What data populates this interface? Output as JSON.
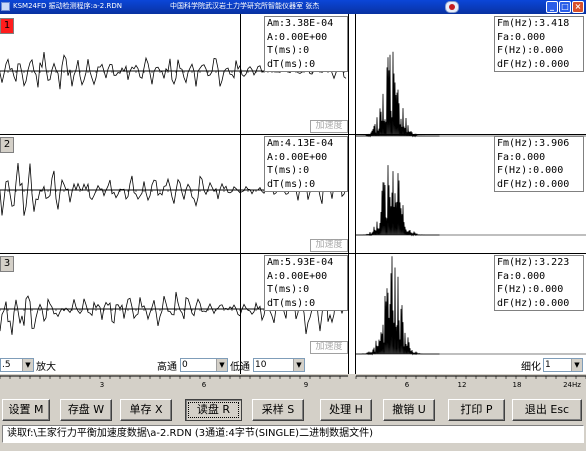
{
  "window": {
    "title_left": "KSM24FD  振动检测程序:a-2.RDN",
    "title_center": "中国科学院武汉岩土力学研究所智能仪器室    张杰"
  },
  "channels": [
    {
      "number": "1",
      "time_stats": {
        "am": "Am:3.38E-04",
        "a": " A:0.00E+00",
        "t": " T(ms):0",
        "dt": "dT(ms):0"
      },
      "freq_stats": {
        "fm": "Fm(Hz):3.418",
        "fa": "Fa:0.000",
        "f": " F(Hz):0.000",
        "df": "dF(Hz):0.000"
      },
      "quantity": "加速度"
    },
    {
      "number": "2",
      "time_stats": {
        "am": "Am:4.13E-04",
        "a": " A:0.00E+00",
        "t": " T(ms):0",
        "dt": "dT(ms):0"
      },
      "freq_stats": {
        "fm": "Fm(Hz):3.906",
        "fa": "Fa:0.000",
        "f": " F(Hz):0.000",
        "df": "dF(Hz):0.000"
      },
      "quantity": "加速度"
    },
    {
      "number": "3",
      "time_stats": {
        "am": "Am:5.93E-04",
        "a": " A:0.00E+00",
        "t": " T(ms):0",
        "dt": "dT(ms):0"
      },
      "freq_stats": {
        "fm": "Fm(Hz):3.223",
        "fa": "Fa:0.000",
        "f": " F(Hz):0.000",
        "df": "dF(Hz):0.000"
      },
      "quantity": "加速度"
    }
  ],
  "controls": {
    "gain_value": ".5",
    "gain_label": "放大",
    "highpass_label": "高通",
    "highpass_value": "0",
    "lowpass_label": "低通",
    "lowpass_value": "10",
    "refine_label": "细化",
    "refine_value": "1"
  },
  "axes": {
    "time_ticks": [
      "3",
      "6",
      "9"
    ],
    "freq_ticks": [
      "6",
      "12",
      "18",
      "24Hz"
    ]
  },
  "buttons": [
    {
      "label": "设置 M"
    },
    {
      "label": "存盘 W"
    },
    {
      "label": "单存 X"
    },
    {
      "label": "读盘 R"
    },
    {
      "label": "采样 S"
    },
    {
      "label": "处理 H"
    },
    {
      "label": "撤销 U"
    },
    {
      "label": "打印 P"
    },
    {
      "label": "退出 Esc"
    }
  ],
  "status_text": "读取f:\\王家行力平衡加速度数据\\a-2.RDN (3通道:4字节(SINGLE)二进制数据文件)",
  "colors": {
    "title_bar": "#0a3ab8",
    "channel1_marker": "#ff1c1c",
    "quantity_label": "#a8a8a8"
  }
}
